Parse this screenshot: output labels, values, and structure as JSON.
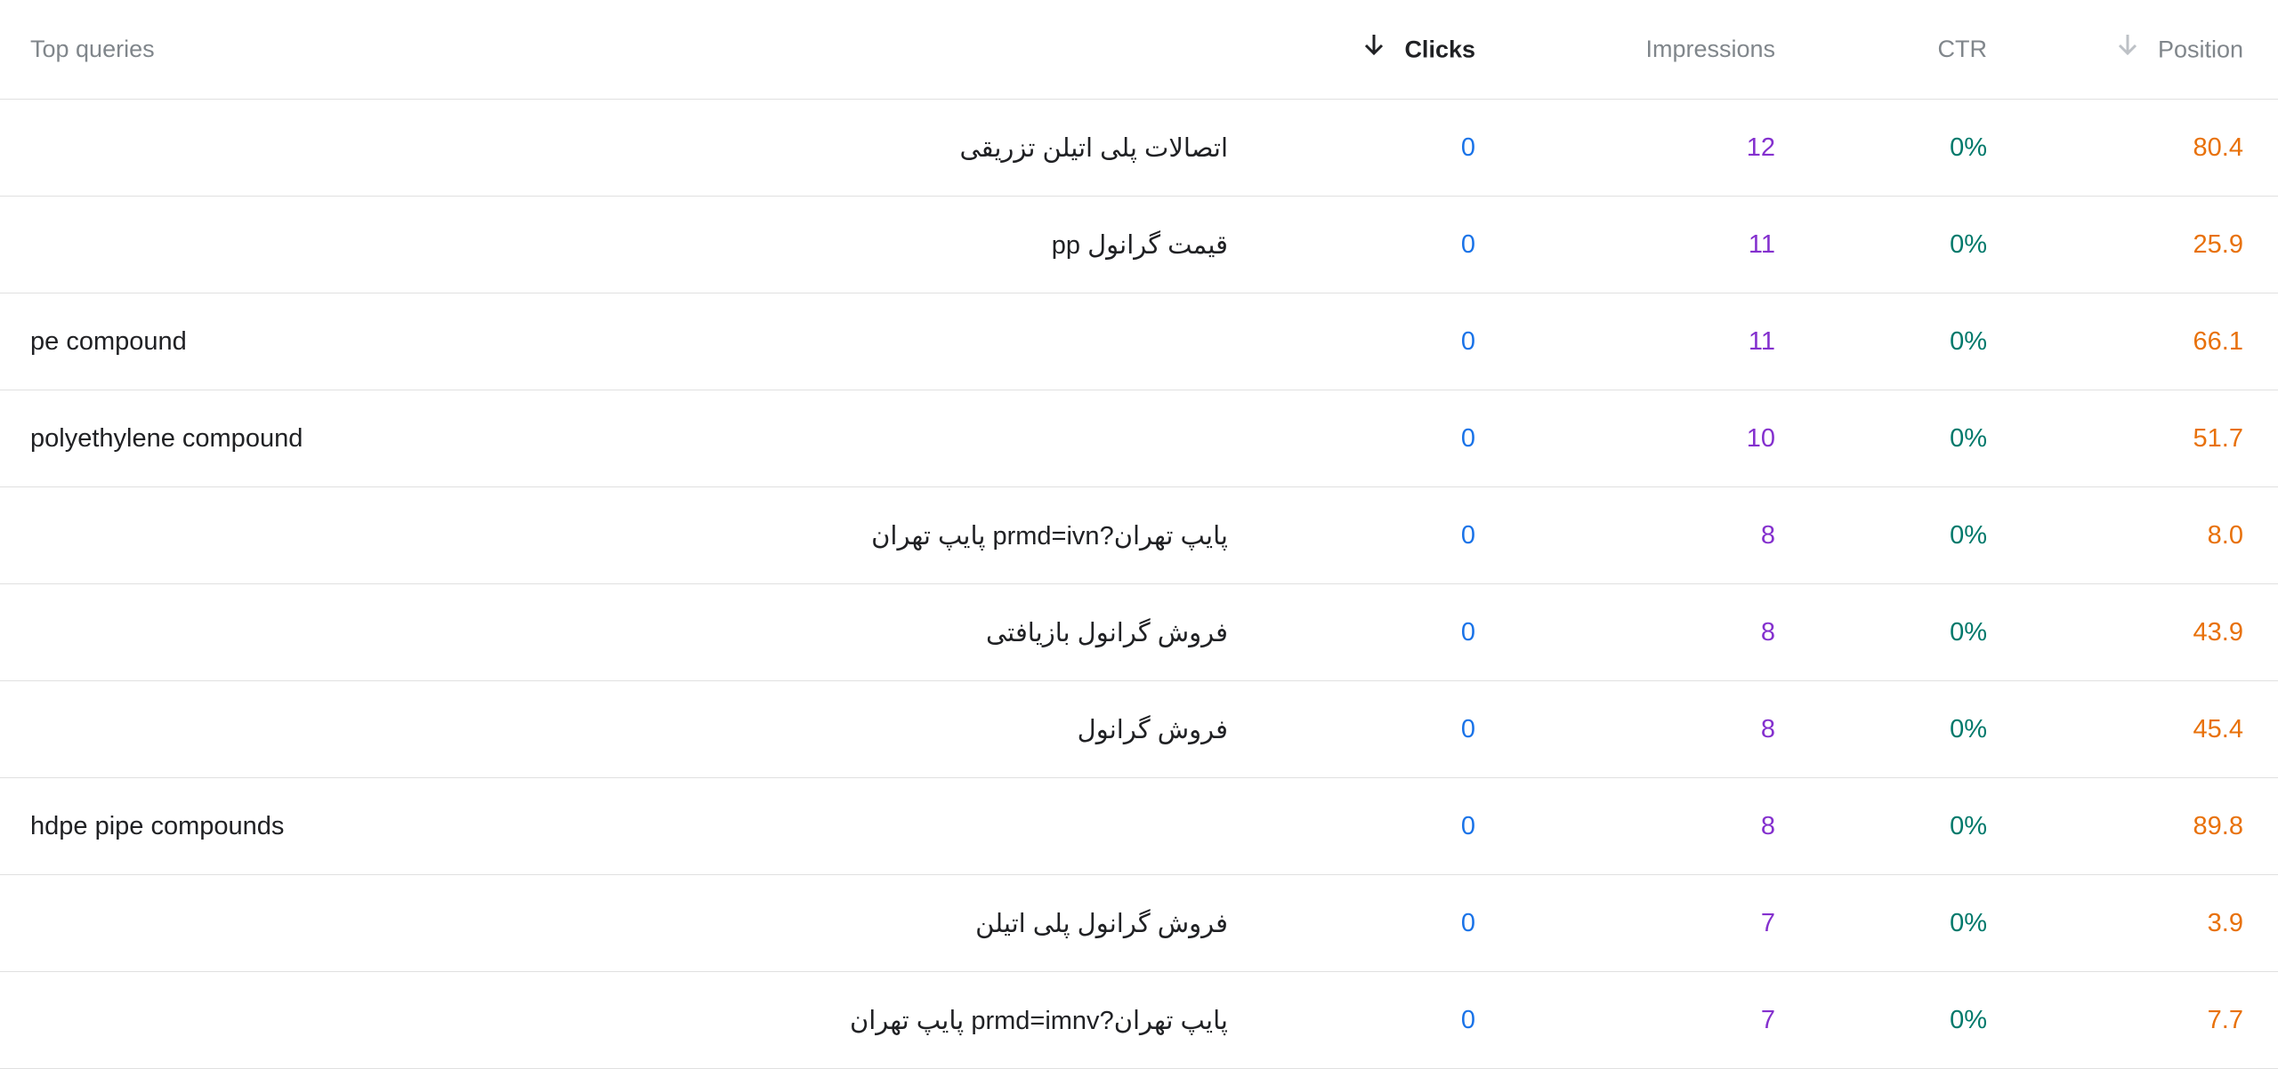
{
  "header": {
    "query_label": "Top queries",
    "clicks_label": "Clicks",
    "impressions_label": "Impressions",
    "ctr_label": "CTR",
    "position_label": "Position",
    "clicks_sort_icon": "arrow-down-icon",
    "position_sort_icon": "arrow-down-icon"
  },
  "colors": {
    "clicks": "#1a73e8",
    "impressions": "#8430ce",
    "ctr": "#00796b",
    "position": "#e8710a"
  },
  "rows": [
    {
      "query": "اتصالات پلی اتیلن تزریقی",
      "clicks": "0",
      "impressions": "12",
      "ctr": "0%",
      "position": "80.4"
    },
    {
      "query": "قیمت گرانول pp",
      "clicks": "0",
      "impressions": "11",
      "ctr": "0%",
      "position": "25.9"
    },
    {
      "query": "pe compound",
      "clicks": "0",
      "impressions": "11",
      "ctr": "0%",
      "position": "66.1"
    },
    {
      "query": "polyethylene compound",
      "clicks": "0",
      "impressions": "10",
      "ctr": "0%",
      "position": "51.7"
    },
    {
      "query": "پایپ تهران?prmd=ivn پایپ تهران",
      "clicks": "0",
      "impressions": "8",
      "ctr": "0%",
      "position": "8.0"
    },
    {
      "query": "فروش گرانول بازیافتی",
      "clicks": "0",
      "impressions": "8",
      "ctr": "0%",
      "position": "43.9"
    },
    {
      "query": "فروش گرانول",
      "clicks": "0",
      "impressions": "8",
      "ctr": "0%",
      "position": "45.4"
    },
    {
      "query": "hdpe pipe compounds",
      "clicks": "0",
      "impressions": "8",
      "ctr": "0%",
      "position": "89.8"
    },
    {
      "query": "فروش گرانول پلی اتیلن",
      "clicks": "0",
      "impressions": "7",
      "ctr": "0%",
      "position": "3.9"
    },
    {
      "query": "پایپ تهران?prmd=imnv پایپ تهران",
      "clicks": "0",
      "impressions": "7",
      "ctr": "0%",
      "position": "7.7"
    }
  ]
}
